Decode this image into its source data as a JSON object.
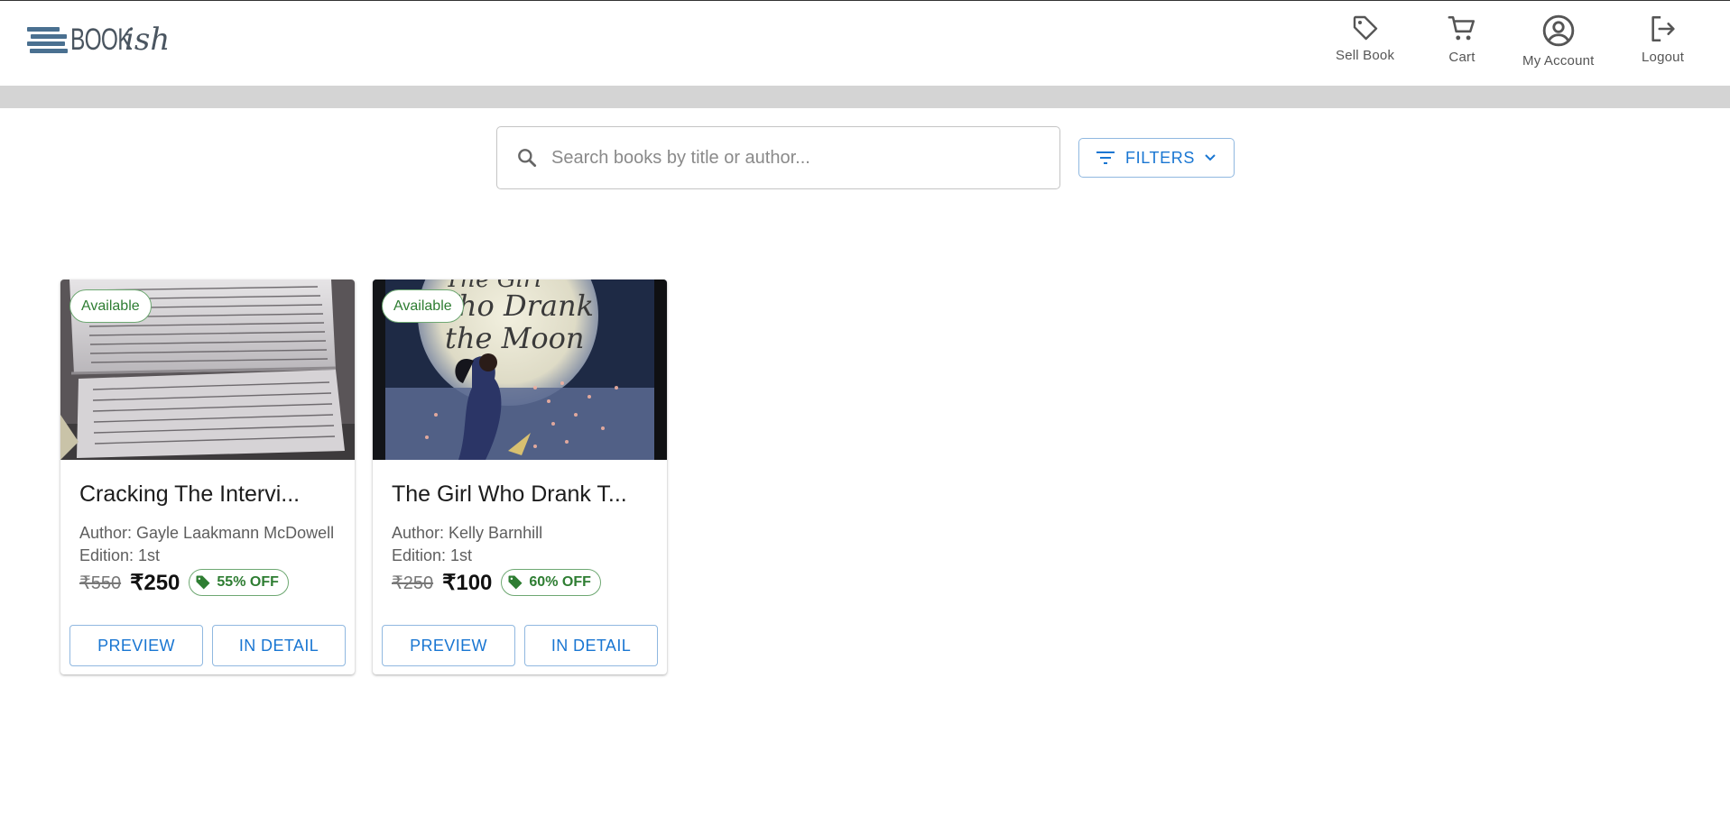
{
  "brand": {
    "logo_text_a": "BOOK",
    "logo_text_b": "ish",
    "logo_color": "#4a7090"
  },
  "nav": {
    "items": [
      {
        "label": "Sell Book",
        "icon": "tag-icon"
      },
      {
        "label": "Cart",
        "icon": "cart-icon"
      },
      {
        "label": "My Account",
        "icon": "account-circle-icon"
      },
      {
        "label": "Logout",
        "icon": "logout-icon"
      }
    ]
  },
  "search": {
    "placeholder": "Search books by title or author...",
    "value": "",
    "icon": "search-icon"
  },
  "filters": {
    "label": "FILTERS",
    "icon": "filter-icon"
  },
  "colors": {
    "accent": "#1976d2",
    "available": "#2e7d32",
    "band": "#d4d4d4"
  },
  "books": [
    {
      "status": "Available",
      "title": "Cracking The Intervi...",
      "author": "Author: Gayle Laakmann McDowell",
      "edition": "Edition: 1st",
      "original_price": "₹550",
      "price": "₹250",
      "discount": "55% OFF",
      "preview_label": "PREVIEW",
      "detail_label": "IN DETAIL"
    },
    {
      "status": "Available",
      "title": "The Girl Who Drank T...",
      "author": "Author: Kelly Barnhill",
      "edition": "Edition: 1st",
      "original_price": "₹250",
      "price": "₹100",
      "discount": "60% OFF",
      "preview_label": "PREVIEW",
      "detail_label": "IN DETAIL"
    }
  ]
}
